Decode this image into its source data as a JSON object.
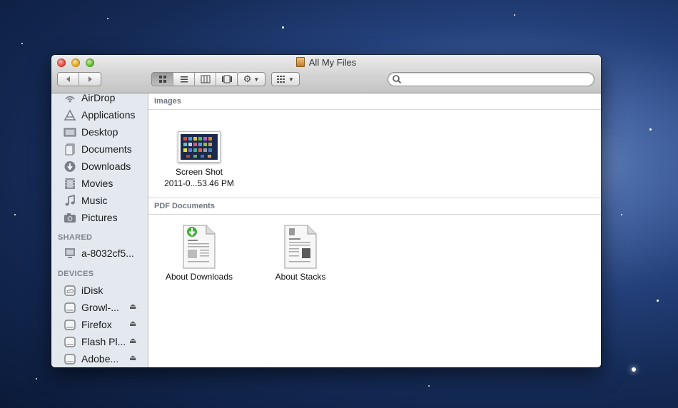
{
  "window": {
    "title": "All My Files"
  },
  "toolbar": {
    "back_icon": "back-arrow-icon",
    "forward_icon": "forward-arrow-icon",
    "view_modes": [
      "icon-view",
      "list-view",
      "column-view",
      "cover-flow-view"
    ],
    "active_view": "icon-view",
    "action_icon": "gear-icon",
    "arrange_icon": "arrange-grid-icon",
    "search": {
      "value": "",
      "placeholder": ""
    }
  },
  "sidebar": {
    "favorites": [
      {
        "label": "AirDrop",
        "icon": "airdrop-icon"
      },
      {
        "label": "Applications",
        "icon": "applications-icon"
      },
      {
        "label": "Desktop",
        "icon": "desktop-icon"
      },
      {
        "label": "Documents",
        "icon": "documents-icon"
      },
      {
        "label": "Downloads",
        "icon": "downloads-icon"
      },
      {
        "label": "Movies",
        "icon": "movies-icon"
      },
      {
        "label": "Music",
        "icon": "music-icon"
      },
      {
        "label": "Pictures",
        "icon": "pictures-icon"
      }
    ],
    "shared_heading": "SHARED",
    "shared": [
      {
        "label": "a-8032cf5...",
        "icon": "computer-icon"
      }
    ],
    "devices_heading": "DEVICES",
    "devices": [
      {
        "label": "iDisk",
        "icon": "idisk-icon",
        "eject": false
      },
      {
        "label": "Growl-...",
        "icon": "disk-icon",
        "eject": true
      },
      {
        "label": "Firefox",
        "icon": "disk-icon",
        "eject": true
      },
      {
        "label": "Flash Pl...",
        "icon": "disk-icon",
        "eject": true
      },
      {
        "label": "Adobe...",
        "icon": "disk-icon",
        "eject": true
      }
    ],
    "eject_glyph": "⏏"
  },
  "content": {
    "groups": [
      {
        "title": "Images",
        "files": [
          {
            "line1": "Screen Shot",
            "line2": "2011-0...53.46 PM",
            "icon": "screenshot-thumbnail"
          }
        ]
      },
      {
        "title": "PDF Documents",
        "files": [
          {
            "line1": "About Downloads",
            "icon": "pdf-document-icon"
          },
          {
            "line1": "About Stacks",
            "icon": "pdf-document-icon"
          }
        ]
      }
    ]
  },
  "colors": {
    "sidebar_bg": "#e4e9ef",
    "sidebar_heading": "#7d8590",
    "titlebar_top": "#ececec",
    "titlebar_bottom": "#c4c4c4"
  }
}
